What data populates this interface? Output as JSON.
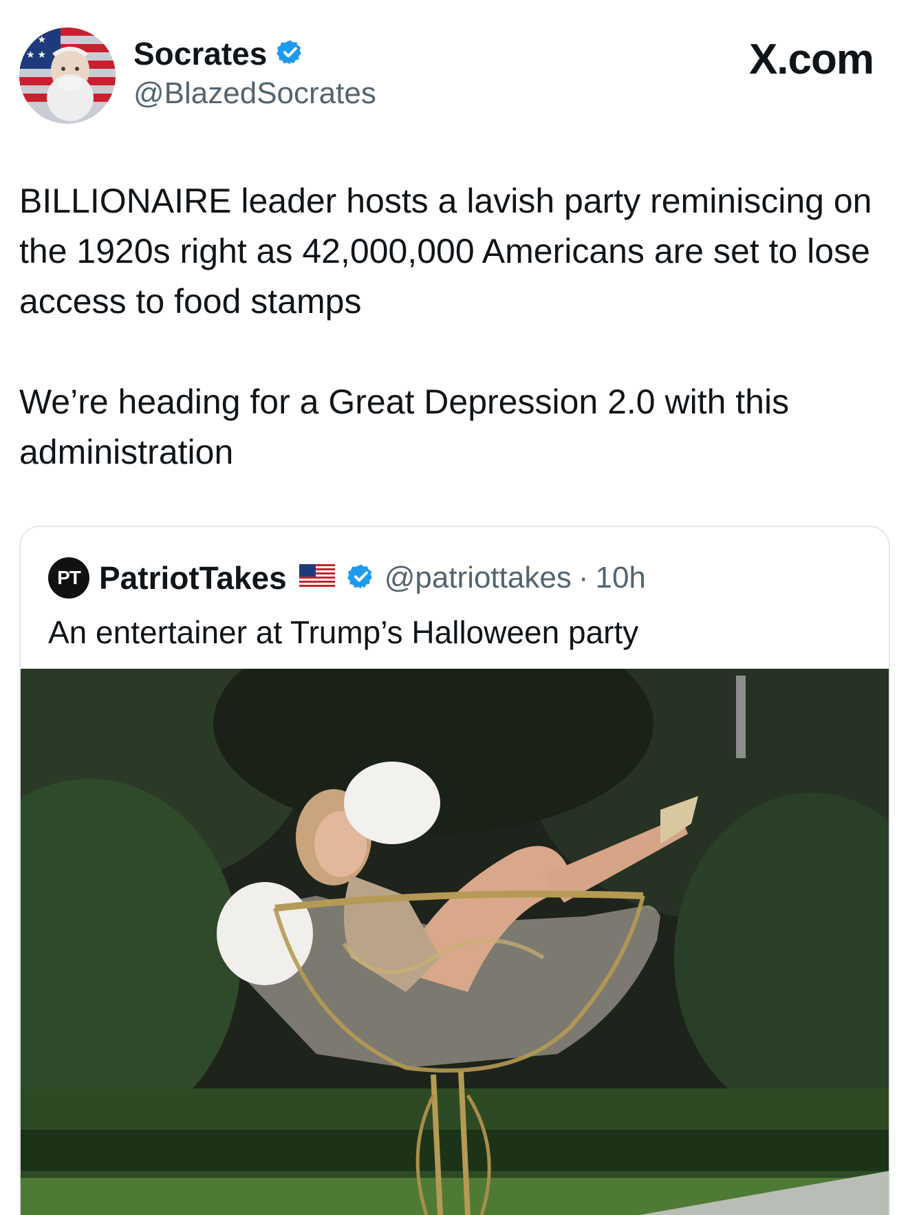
{
  "author": {
    "name": "Socrates",
    "handle": "@BlazedSocrates",
    "verified": true
  },
  "brand": "X.com",
  "tweet": {
    "paragraph1": "BILLIONAIRE leader hosts a lavish party reminiscing on the 1920s right as 42,000,000 Americans are set to lose access to food stamps",
    "paragraph2": "We’re heading for a Great Depression 2.0 with this administration"
  },
  "quoted": {
    "logo_text": "PT",
    "name": "PatriotTakes",
    "flag_icon": "us-flag-icon",
    "verified": true,
    "handle": "@patriottakes",
    "separator": "·",
    "time": "10h",
    "text": "An entertainer at Trump’s Halloween party"
  },
  "colors": {
    "verified_blue": "#1d9bf0",
    "secondary_text": "#536471",
    "border": "#e3e7ea"
  }
}
